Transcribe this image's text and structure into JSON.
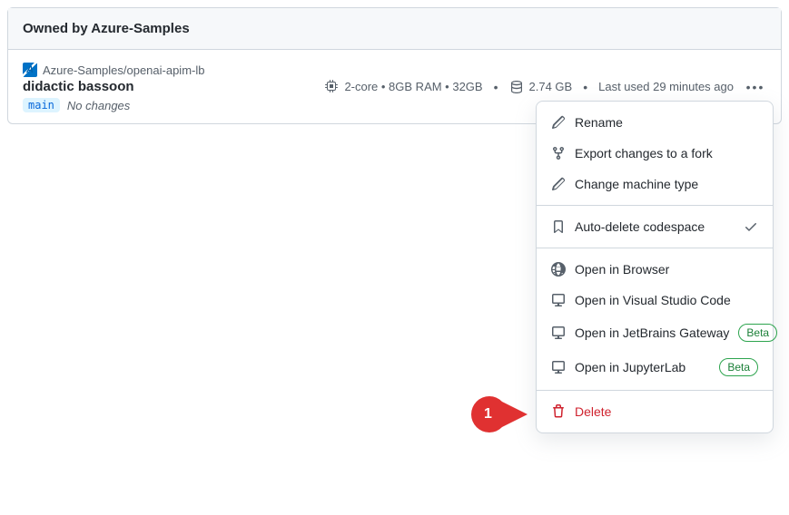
{
  "header": {
    "title": "Owned by Azure-Samples"
  },
  "repo": {
    "avatar_letter": "A",
    "path": "Azure-Samples/openai-apim-lb"
  },
  "codespace": {
    "name": "didactic bassoon",
    "specs": "2-core • 8GB RAM • 32GB",
    "storage": "2.74 GB",
    "last_used": "Last used 29 minutes ago",
    "branch": "main",
    "status": "No changes"
  },
  "menu": {
    "rename": "Rename",
    "export_fork": "Export changes to a fork",
    "change_machine": "Change machine type",
    "auto_delete": "Auto-delete codespace",
    "open_browser": "Open in Browser",
    "open_vscode": "Open in Visual Studio Code",
    "open_jetbrains": "Open in JetBrains Gateway",
    "open_jupyter": "Open in JupyterLab",
    "delete": "Delete",
    "beta": "Beta"
  },
  "callout": {
    "num": "1"
  }
}
